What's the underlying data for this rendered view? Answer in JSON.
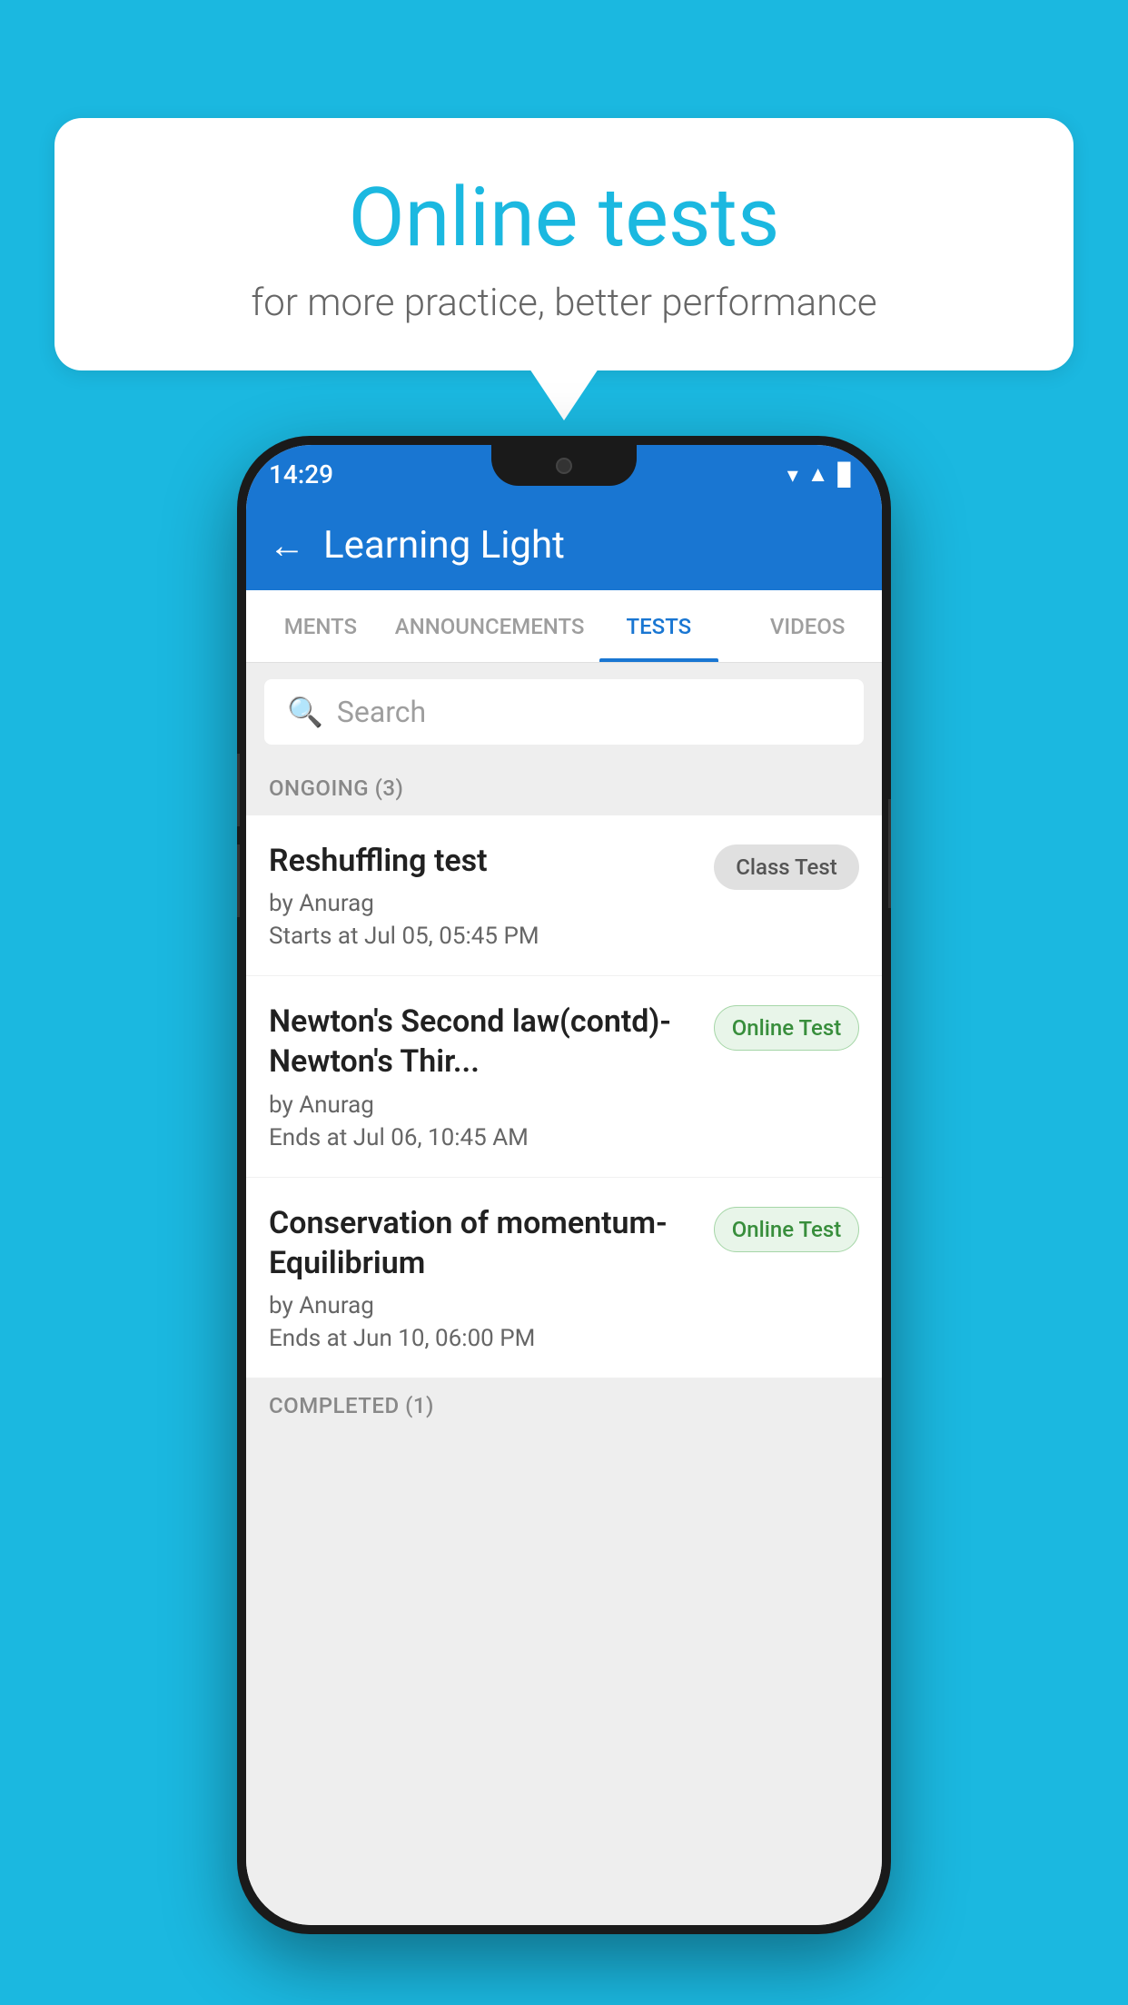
{
  "background_color": "#1BB8E0",
  "bubble": {
    "title": "Online tests",
    "subtitle": "for more practice, better performance"
  },
  "phone": {
    "status_bar": {
      "time": "14:29",
      "icons": [
        "wifi",
        "signal",
        "battery"
      ]
    },
    "header": {
      "title": "Learning Light",
      "back_label": "←"
    },
    "tabs": [
      {
        "label": "MENTS",
        "active": false
      },
      {
        "label": "ANNOUNCEMENTS",
        "active": false
      },
      {
        "label": "TESTS",
        "active": true
      },
      {
        "label": "VIDEOS",
        "active": false
      }
    ],
    "search": {
      "placeholder": "Search"
    },
    "section_ongoing": {
      "label": "ONGOING (3)"
    },
    "tests": [
      {
        "name": "Reshuffling test",
        "author": "by Anurag",
        "time": "Starts at  Jul 05, 05:45 PM",
        "badge": "Class Test",
        "badge_type": "class"
      },
      {
        "name": "Newton's Second law(contd)-Newton's Thir...",
        "author": "by Anurag",
        "time": "Ends at  Jul 06, 10:45 AM",
        "badge": "Online Test",
        "badge_type": "online"
      },
      {
        "name": "Conservation of momentum-Equilibrium",
        "author": "by Anurag",
        "time": "Ends at  Jun 10, 06:00 PM",
        "badge": "Online Test",
        "badge_type": "online"
      }
    ],
    "section_completed": {
      "label": "COMPLETED (1)"
    }
  }
}
